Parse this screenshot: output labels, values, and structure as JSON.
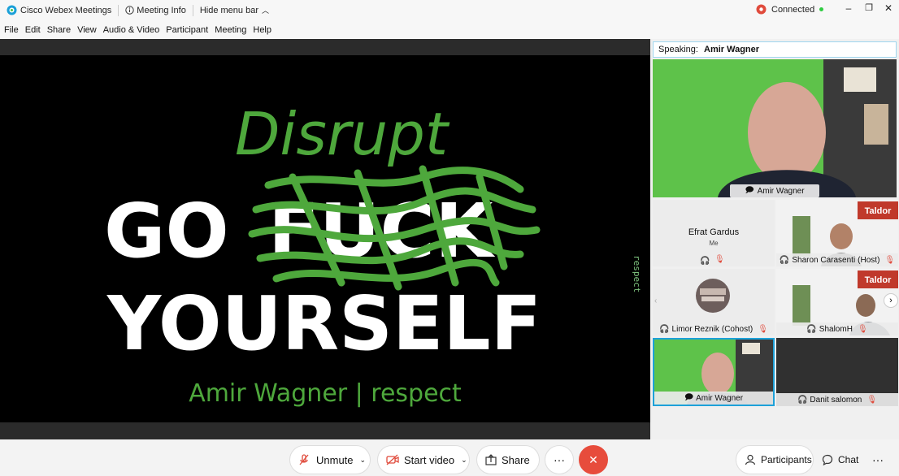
{
  "titlebar": {
    "app_title": "Cisco Webex Meetings",
    "meeting_info": "Meeting Info",
    "hide_menu": "Hide menu bar",
    "status": "Connected"
  },
  "menu": [
    "File",
    "Edit",
    "Share",
    "View",
    "Audio & Video",
    "Participant",
    "Meeting",
    "Help"
  ],
  "slide": {
    "top_word": "Disrupt",
    "line1": "GO",
    "crossed_word": "FUCK",
    "line2": "YOURSELF",
    "footer": "Amir Wagner | respect",
    "side_text": "respect"
  },
  "speaking": {
    "label": "Speaking:",
    "name": "Amir Wagner"
  },
  "active_video": {
    "name": "Amir Wagner"
  },
  "participants": [
    {
      "name": "Efrat Gardus",
      "sub": "Me"
    },
    {
      "name": "Sharon Carasenti",
      "role": "(Host)"
    },
    {
      "name": "Limor Reznik",
      "role": "(Cohost)"
    },
    {
      "name": "ShalomH"
    },
    {
      "name": "Amir Wagner"
    },
    {
      "name": "Danit salomon"
    }
  ],
  "brand_text": "Taldor",
  "controls": {
    "unmute": "Unmute",
    "start_video": "Start video",
    "share": "Share",
    "more": "···",
    "participants": "Participants",
    "chat": "Chat"
  },
  "colors": {
    "accent": "#4ea83c",
    "leave": "#e74c3c",
    "connected": "#2ecc40",
    "highlight": "#1da1d9"
  }
}
